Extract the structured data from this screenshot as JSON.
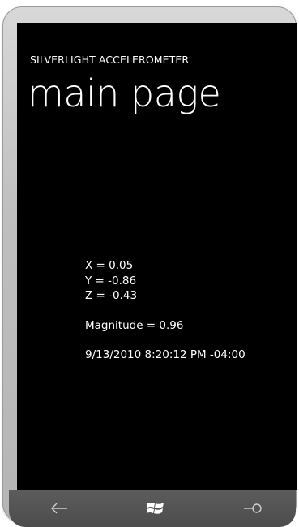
{
  "app": {
    "title": "SILVERLIGHT ACCELEROMETER",
    "page_title": "main page"
  },
  "readout": {
    "x_line": "X = 0.05",
    "y_line": "Y = -0.86",
    "z_line": "Z = -0.43",
    "magnitude_line": "Magnitude = 0.96",
    "timestamp": "9/13/2010 8:20:12 PM -04:00"
  },
  "hardware_buttons": {
    "back": "back-arrow-icon",
    "start": "windows-logo-icon",
    "search": "search-icon"
  },
  "colors": {
    "screen_background": "#000000",
    "text": "#ffffff",
    "button_bar": "#525252"
  }
}
